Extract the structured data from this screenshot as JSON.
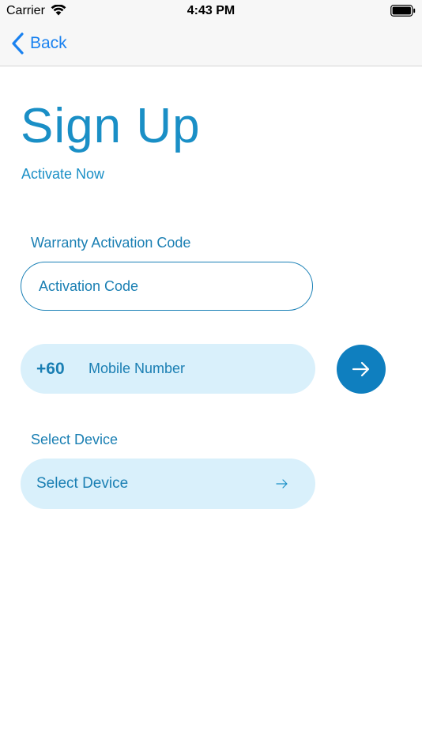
{
  "status_bar": {
    "carrier": "Carrier",
    "time": "4:43 PM",
    "icons": [
      "wifi-icon",
      "battery-icon"
    ]
  },
  "nav": {
    "back_label": "Back",
    "back_icon": "chevron-left-icon"
  },
  "header": {
    "title": "Sign Up",
    "subtitle": "Activate Now"
  },
  "activation": {
    "label": "Warranty Activation Code",
    "placeholder": "Activation Code",
    "value": ""
  },
  "mobile": {
    "country_code": "+60",
    "placeholder": "Mobile Number",
    "value": "",
    "submit_icon": "arrow-right-icon"
  },
  "device": {
    "label": "Select Device",
    "placeholder": "Select Device",
    "icon": "arrow-right-icon"
  },
  "colors": {
    "accent": "#1a8fc6",
    "accent_dark": "#0f7fbf",
    "pill_background": "#d9f0fb",
    "ios_blue": "#1a82f0"
  }
}
